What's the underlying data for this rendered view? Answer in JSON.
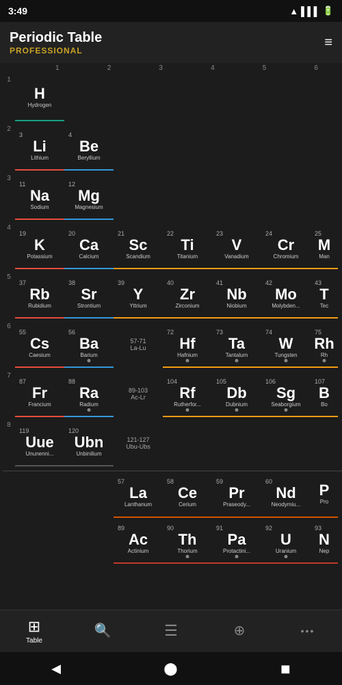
{
  "statusBar": {
    "time": "3:49"
  },
  "header": {
    "title": "Periodic Table",
    "subtitle": "PROFESSIONAL",
    "filterLabel": "filter"
  },
  "columns": [
    "1",
    "2",
    "3",
    "4",
    "5",
    "6"
  ],
  "periods": [
    {
      "num": "1",
      "cells": [
        {
          "num": "",
          "symbol": "H",
          "name": "Hydrogen",
          "cat": "nonmetal",
          "dot": false
        }
      ]
    }
  ],
  "navItems": [
    {
      "label": "Table",
      "icon": "⊞",
      "active": true
    },
    {
      "label": "Search",
      "icon": "🔍",
      "active": false
    },
    {
      "label": "List",
      "icon": "☰",
      "active": false
    },
    {
      "label": "Compare",
      "icon": "⊕",
      "active": false
    },
    {
      "label": "More",
      "icon": "···",
      "active": false
    }
  ]
}
